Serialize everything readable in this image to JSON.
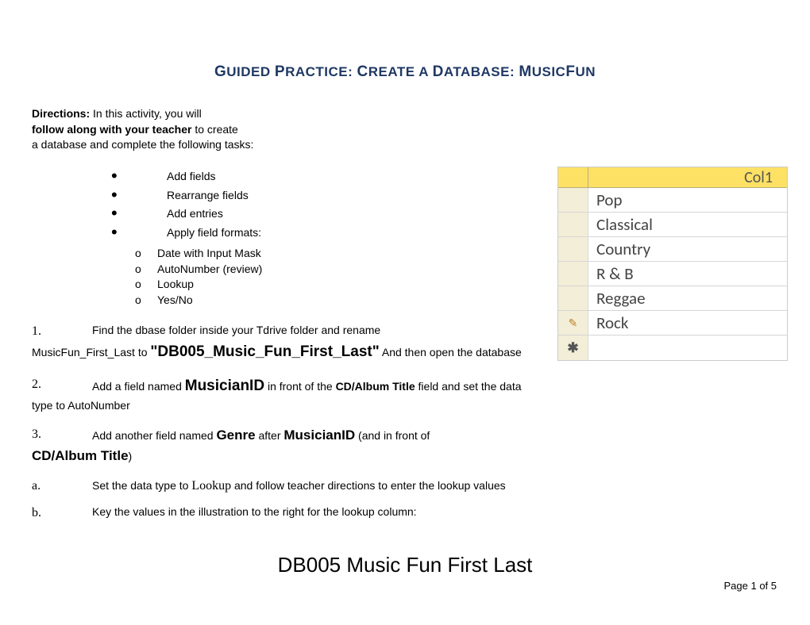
{
  "title": {
    "part1_cap": "G",
    "part1_rest": "UIDED ",
    "part2_cap": "P",
    "part2_rest": "RACTICE:   ",
    "part3_cap": "C",
    "part3_rest": "REATE A ",
    "part4_cap": "D",
    "part4_rest": "ATABASE:   ",
    "part5_cap": "M",
    "part5_rest": "USIC",
    "part6_cap": "F",
    "part6_rest": "UN"
  },
  "directions": {
    "label": "Directions:",
    "line1": "  In this activity, you will",
    "line2_bold": "follow along with your teacher",
    "line2_rest": " to create",
    "line3": "a database and complete the following tasks:"
  },
  "bullets": [
    "Add fields",
    "Rearrange fields",
    "Add entries",
    "Apply field formats:"
  ],
  "subitems": [
    "Date with Input Mask",
    "AutoNumber (review)",
    "Lookup",
    "Yes/No"
  ],
  "steps": {
    "s1": {
      "num": "1.",
      "text_a": "Find the dbase folder inside your Tdrive folder  and rename",
      "text_b_pre": "MusicFun_First_Last to ",
      "text_b_bold": "\"DB005_Music_Fun_First_Last\"",
      "text_b_post": " And then open the database"
    },
    "s2": {
      "num": "2.",
      "pre": "Add a field named ",
      "bold1": "MusicianID",
      "mid": " in front of the ",
      "bold2": "CD/Album Title",
      "post": " field and set the data type to AutoNumber"
    },
    "s3": {
      "num": "3.",
      "pre": "Add another field named ",
      "bold1": "Genre",
      "mid": " after ",
      "bold2": "MusicianID",
      "post1": " (and in front of ",
      "bold3": "CD/Album Title",
      "post2": ")"
    },
    "sa": {
      "letter": "a.",
      "pre": "Set the data type to ",
      "serif": "Lookup",
      "post": " and follow teacher directions to enter the lookup values"
    },
    "sb": {
      "letter": "b.",
      "text": "Key the values in the illustration to the right for the lookup column:"
    }
  },
  "access_table": {
    "header_partial": "Col1",
    "rows": [
      "Pop",
      "Classical",
      "Country",
      "R & B",
      "Reggae",
      "Rock"
    ],
    "edit_row_index": 5
  },
  "footer_title": "DB005 Music Fun First Last",
  "page_num": "Page 1 of 5"
}
